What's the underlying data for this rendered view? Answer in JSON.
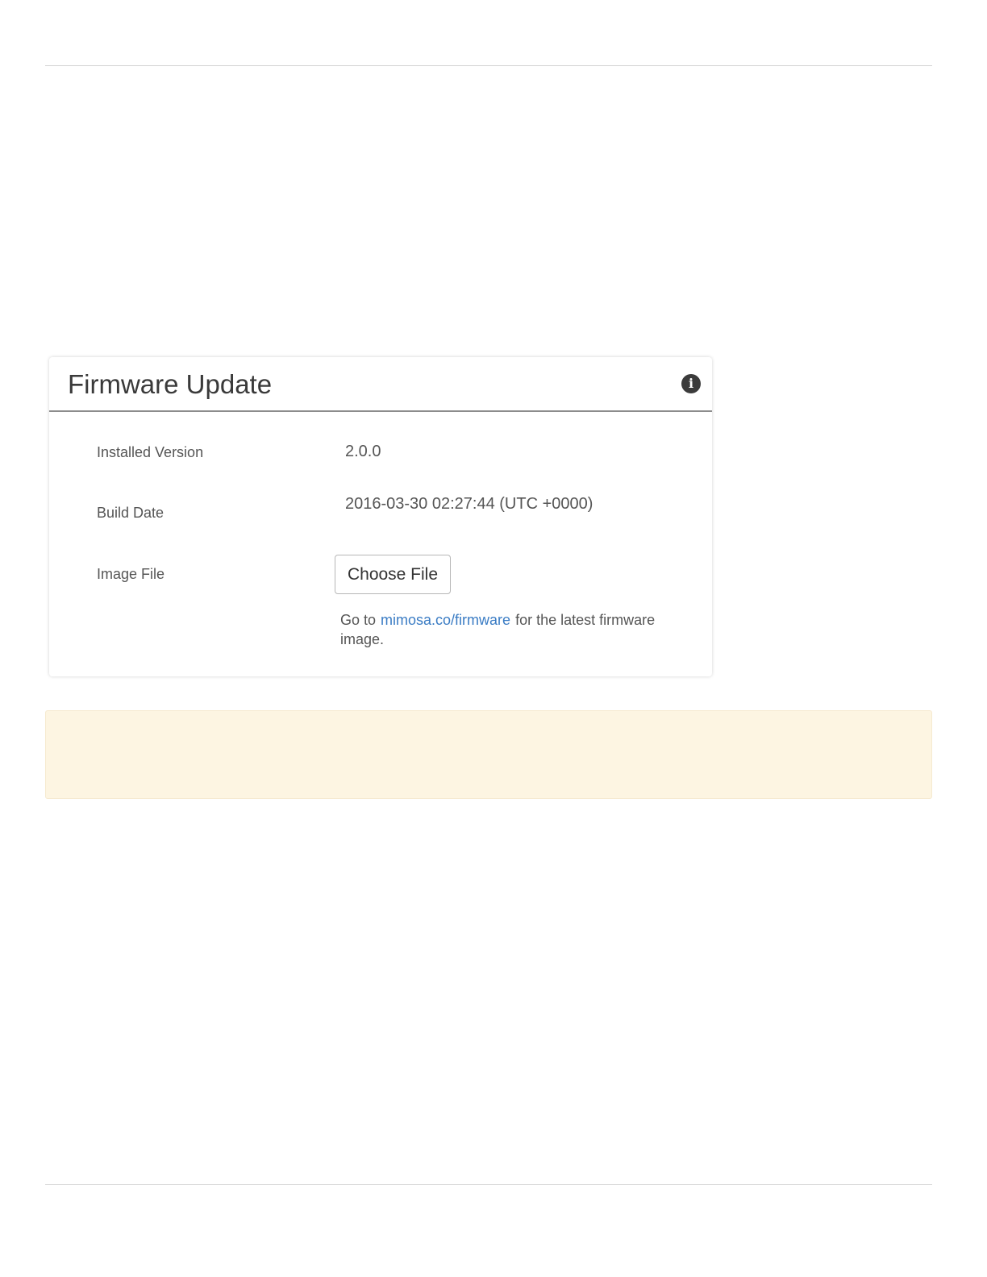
{
  "panel": {
    "title": "Firmware Update",
    "info_icon": "info-icon"
  },
  "fields": {
    "installed_version": {
      "label": "Installed Version",
      "value": "2.0.0"
    },
    "build_date": {
      "label": "Build Date",
      "value": "2016-03-30 02:27:44 (UTC +0000)"
    },
    "image_file": {
      "label": "Image File",
      "button_label": "Choose File"
    }
  },
  "help": {
    "prefix": "Go to",
    "link_text": "mimosa.co/firmware",
    "suffix": "for the latest firmware image."
  },
  "colors": {
    "link": "#3a7cc4",
    "notice_background": "#fdf5e2",
    "header_rule": "#8c8c8c"
  }
}
